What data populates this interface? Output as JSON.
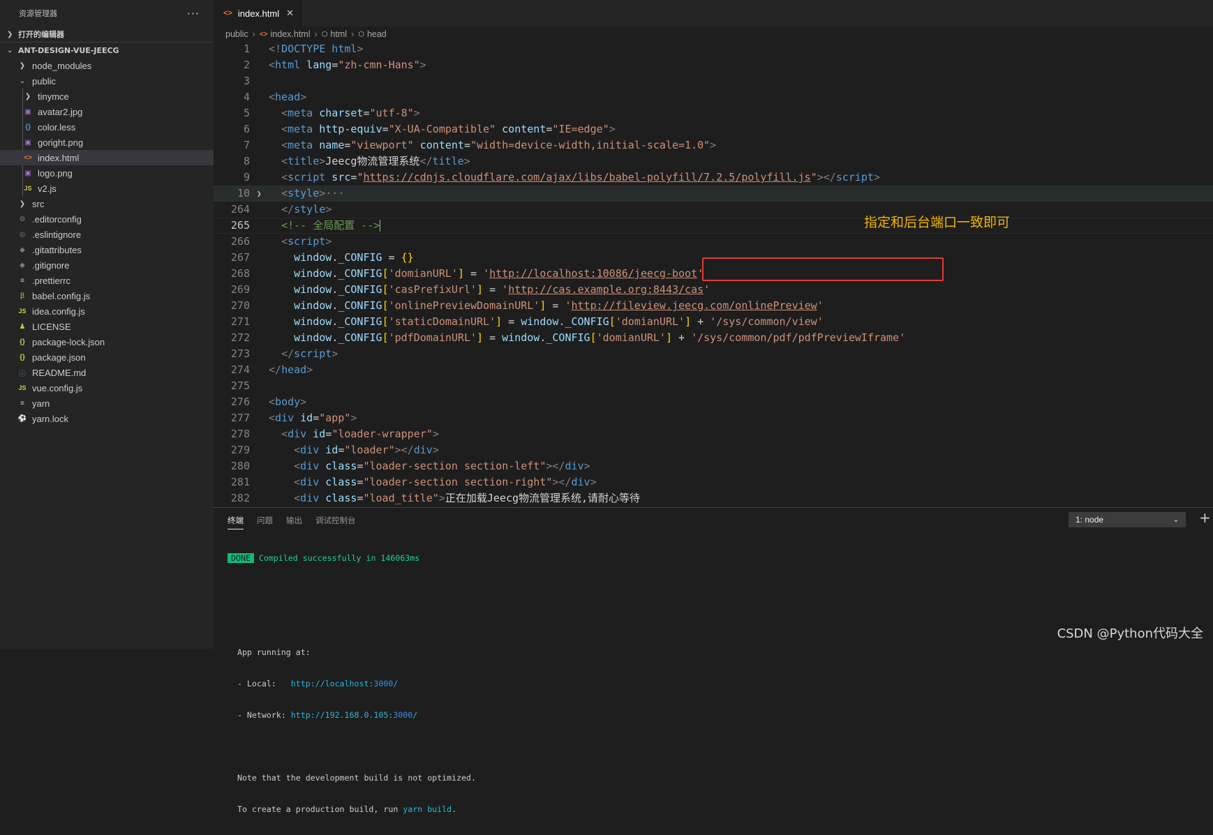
{
  "sidebar": {
    "title": "资源管理器",
    "more": "···",
    "open_editors": "打开的编辑器",
    "project": "ANT-DESIGN-VUE-JEECG",
    "tree": [
      {
        "label": "node_modules",
        "icon": "chevron-right-icon"
      },
      {
        "label": "public",
        "icon": "chevron-down-icon"
      },
      {
        "label": "tinymce",
        "icon": "chevron-right-icon"
      },
      {
        "label": "avatar2.jpg",
        "icon": "image-file-icon"
      },
      {
        "label": "color.less",
        "icon": "less-file-icon"
      },
      {
        "label": "goright.png",
        "icon": "image-file-icon"
      },
      {
        "label": "index.html",
        "icon": "html-file-icon"
      },
      {
        "label": "logo.png",
        "icon": "image-file-icon"
      },
      {
        "label": "v2.js",
        "icon": "js-file-icon"
      },
      {
        "label": "src",
        "icon": "chevron-right-icon"
      },
      {
        "label": ".editorconfig",
        "icon": "gear-file-icon"
      },
      {
        "label": ".eslintignore",
        "icon": "eslint-file-icon"
      },
      {
        "label": ".gitattributes",
        "icon": "git-file-icon"
      },
      {
        "label": ".gitignore",
        "icon": "git-file-icon"
      },
      {
        "label": ".prettierrc",
        "icon": "text-file-icon"
      },
      {
        "label": "babel.config.js",
        "icon": "babel-file-icon"
      },
      {
        "label": "idea.config.js",
        "icon": "js-file-icon"
      },
      {
        "label": "LICENSE",
        "icon": "license-file-icon"
      },
      {
        "label": "package-lock.json",
        "icon": "json-file-icon"
      },
      {
        "label": "package.json",
        "icon": "json-file-icon"
      },
      {
        "label": "README.md",
        "icon": "info-file-icon"
      },
      {
        "label": "vue.config.js",
        "icon": "js-file-icon"
      },
      {
        "label": "yarn",
        "icon": "text-file-icon"
      },
      {
        "label": "yarn.lock",
        "icon": "yarn-file-icon"
      }
    ]
  },
  "editor": {
    "tab": {
      "label": "index.html",
      "close": "✕"
    },
    "breadcrumb": [
      "public",
      "index.html",
      "html",
      "head"
    ],
    "line_numbers": [
      "1",
      "2",
      "3",
      "4",
      "5",
      "6",
      "7",
      "8",
      "9",
      "10",
      "264",
      "265",
      "266",
      "267",
      "268",
      "269",
      "270",
      "271",
      "272",
      "273",
      "274",
      "275",
      "276",
      "277",
      "278",
      "279",
      "280",
      "281",
      "282"
    ],
    "code": {
      "l1a": "<!",
      "l1b": "DOCTYPE",
      "l1c": " html",
      "l1d": ">",
      "l2a": "<",
      "l2b": "html",
      "l2c": " lang",
      "l2d": "=",
      "l2e": "\"zh-cmn-Hans\"",
      "l2f": ">",
      "l4a": "<",
      "l4b": "head",
      "l4c": ">",
      "l5a": "<",
      "l5b": "meta",
      "l5c": " charset",
      "l5d": "=",
      "l5e": "\"utf-8\"",
      "l5f": ">",
      "l6a": "<",
      "l6b": "meta",
      "l6c": " http-equiv",
      "l6d": "=",
      "l6e": "\"X-UA-Compatible\"",
      "l6f": " content",
      "l6g": "=",
      "l6h": "\"IE=edge\"",
      "l6i": ">",
      "l7a": "<",
      "l7b": "meta",
      "l7c": " name",
      "l7d": "=",
      "l7e": "\"viewport\"",
      "l7f": " content",
      "l7g": "=",
      "l7h": "\"width=device-width,initial-scale=1.0\"",
      "l7i": ">",
      "l8a": "<",
      "l8b": "title",
      "l8c": ">",
      "l8d": "Jeecg物流管理系统",
      "l8e": "</",
      "l8f": "title",
      "l8g": ">",
      "l9a": "<",
      "l9b": "script",
      "l9c": " src",
      "l9d": "=",
      "l9e": "\"",
      "l9f": "https://cdnjs.cloudflare.com/ajax/libs/babel-polyfill/7.2.5/polyfill.js",
      "l9g": "\"",
      "l9h": "></",
      "l9i": "script",
      "l9j": ">",
      "l10a": "<",
      "l10b": "style",
      "l10c": ">",
      "l10d": "···",
      "l264a": "</",
      "l264b": "style",
      "l264c": ">",
      "l265a": "<!-- 全局配置 -->",
      "l266a": "<",
      "l266b": "script",
      "l266c": ">",
      "l267a": "window",
      "l267b": ".",
      "l267c": "_CONFIG",
      "l267d": " = ",
      "l267e": "{}",
      "l268a": "window",
      "l268b": ".",
      "l268c": "_CONFIG",
      "l268d": "[",
      "l268e": "'domianURL'",
      "l268f": "]",
      "l268g": " = ",
      "l268h": "'",
      "l268i": "http://localhost:10086/jeecg-boot",
      "l268j": "'",
      "l269a": "window",
      "l269b": ".",
      "l269c": "_CONFIG",
      "l269d": "[",
      "l269e": "'casPrefixUrl'",
      "l269f": "]",
      "l269g": " = ",
      "l269h": "'",
      "l269i": "http://cas.example.org:8443/cas",
      "l269j": "'",
      "l270a": "window",
      "l270b": ".",
      "l270c": "_CONFIG",
      "l270d": "[",
      "l270e": "'onlinePreviewDomainURL'",
      "l270f": "]",
      "l270g": " = ",
      "l270h": "'",
      "l270i": "http://fileview.jeecg.com/onlinePreview",
      "l270j": "'",
      "l271a": "window",
      "l271b": ".",
      "l271c": "_CONFIG",
      "l271d": "[",
      "l271e": "'staticDomainURL'",
      "l271f": "]",
      "l271g": " = ",
      "l271h": "window",
      "l271i": ".",
      "l271j": "_CONFIG",
      "l271k": "[",
      "l271l": "'domianURL'",
      "l271m": "]",
      "l271n": " + ",
      "l271o": "'/sys/common/view'",
      "l272a": "window",
      "l272b": ".",
      "l272c": "_CONFIG",
      "l272d": "[",
      "l272e": "'pdfDomainURL'",
      "l272f": "]",
      "l272g": " = ",
      "l272h": "window",
      "l272i": ".",
      "l272j": "_CONFIG",
      "l272k": "[",
      "l272l": "'domianURL'",
      "l272m": "]",
      "l272n": " + ",
      "l272o": "'/sys/common/pdf/pdfPreviewIframe'",
      "l273a": "</",
      "l273b": "script",
      "l273c": ">",
      "l274a": "</",
      "l274b": "head",
      "l274c": ">",
      "l276a": "<",
      "l276b": "body",
      "l276c": ">",
      "l277a": "<",
      "l277b": "div",
      "l277c": " id",
      "l277d": "=",
      "l277e": "\"app\"",
      "l277f": ">",
      "l278a": "<",
      "l278b": "div",
      "l278c": " id",
      "l278d": "=",
      "l278e": "\"loader-wrapper\"",
      "l278f": ">",
      "l279a": "<",
      "l279b": "div",
      "l279c": " id",
      "l279d": "=",
      "l279e": "\"loader\"",
      "l279f": "></",
      "l279g": "div",
      "l279h": ">",
      "l280a": "<",
      "l280b": "div",
      "l280c": " class",
      "l280d": "=",
      "l280e": "\"loader-section section-left\"",
      "l280f": "></",
      "l280g": "div",
      "l280h": ">",
      "l281a": "<",
      "l281b": "div",
      "l281c": " class",
      "l281d": "=",
      "l281e": "\"loader-section section-right\"",
      "l281f": "></",
      "l281g": "div",
      "l281h": ">",
      "l282a": "<",
      "l282b": "div",
      "l282c": " class",
      "l282d": "=",
      "l282e": "\"load_title\"",
      "l282f": ">",
      "l282g": "正在加载Jeecg物流管理系统,请耐心等待"
    },
    "annotation": "指定和后台端口一致即可"
  },
  "panel": {
    "tabs": [
      "终端",
      "问题",
      "输出",
      "调试控制台"
    ],
    "terminal_select": "1: node",
    "add": "+",
    "done_badge": "DONE",
    "compiled": "Compiled successfully in 146063ms",
    "running": "App running at:",
    "local_label": "- Local:   ",
    "local_url_a": "http://localhost:",
    "local_port": "3000",
    "local_url_b": "/",
    "network_label": "- Network: ",
    "network_url_a": "http://192.168.0.105:",
    "network_port": "3000",
    "network_url_b": "/",
    "note1": "Note that the development build is not optimized.",
    "note2_a": "To create a production build, run ",
    "note2_cmd": "yarn build",
    "note2_b": "."
  },
  "watermark": "CSDN @Python代码大全",
  "colors": {
    "tag": "#808080",
    "tagname": "#569cd6",
    "attr": "#9cdcfe",
    "string": "#ce9178",
    "comment": "#6a9955",
    "bracket": "#ffd700",
    "annotation": "#f0b400",
    "highlight_box": "#e53935"
  }
}
